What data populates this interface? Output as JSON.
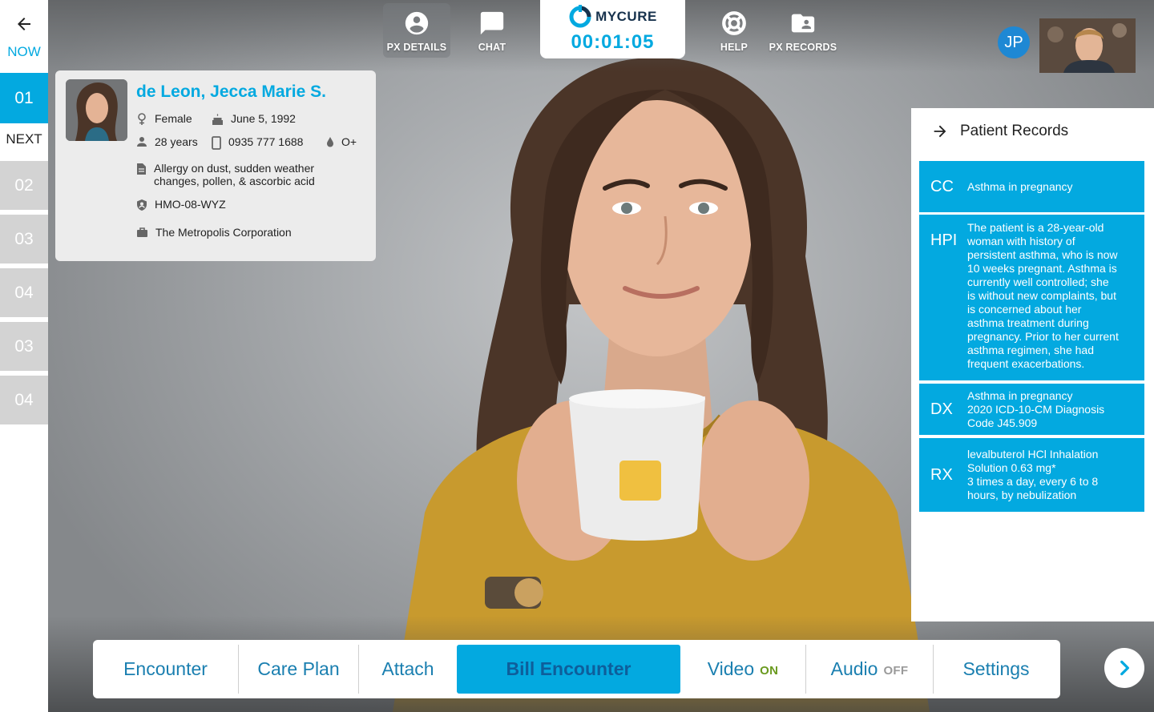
{
  "sidebar": {
    "now_label": "NOW",
    "current": "01",
    "next_label": "NEXT",
    "queue": [
      "02",
      "03",
      "04",
      "03",
      "04"
    ]
  },
  "toolbar": {
    "px_details": "PX DETAILS",
    "chat": "CHAT",
    "help": "HELP",
    "px_records": "PX RECORDS"
  },
  "brand": {
    "name": "MYCURE",
    "timer": "00:01:05"
  },
  "doctor": {
    "initials": "JP"
  },
  "patient": {
    "name": "de Leon, Jecca Marie S.",
    "sex": "Female",
    "birthdate": "June 5, 1992",
    "age": "28 years",
    "phone": "0935 777 1688",
    "blood_type": "O+",
    "allergy_line1": "Allergy on dust, sudden weather",
    "allergy_line2": "changes, pollen, & ascorbic acid",
    "hmo": "HMO-08-WYZ",
    "company": "The Metropolis Corporation"
  },
  "records": {
    "title": "Patient Records",
    "items": [
      {
        "code": "CC",
        "lines": [
          "Asthma in pregnancy"
        ]
      },
      {
        "code": "HPI",
        "lines": [
          "The patient is a 28-year-old",
          "woman with history of",
          "persistent asthma, who is now",
          "10 weeks pregnant. Asthma is",
          "currently well controlled; she",
          "is without new complaints, but",
          "is concerned about her",
          "asthma treatment during",
          "pregnancy. Prior to her current",
          "asthma regimen, she had",
          "frequent exacerbations."
        ]
      },
      {
        "code": "DX",
        "lines": [
          "Asthma in pregnancy",
          "2020 ICD-10-CM Diagnosis",
          "Code J45.909"
        ]
      },
      {
        "code": "RX",
        "lines": [
          "levalbuterol HCl Inhalation",
          "Solution 0.63 mg*",
          "3 times a day, every 6 to 8",
          "hours, by nebulization"
        ]
      }
    ]
  },
  "controls": {
    "encounter": "Encounter",
    "care_plan": "Care Plan",
    "attach": "Attach",
    "bill_encounter": "Bill Encounter",
    "video": "Video",
    "video_state": "ON",
    "audio": "Audio",
    "audio_state": "OFF",
    "settings": "Settings"
  },
  "colors": {
    "accent": "#03a9e0",
    "video_on": "#6a9a1f",
    "audio_off": "#9a9a9a",
    "sweater": "#c89a2e"
  }
}
